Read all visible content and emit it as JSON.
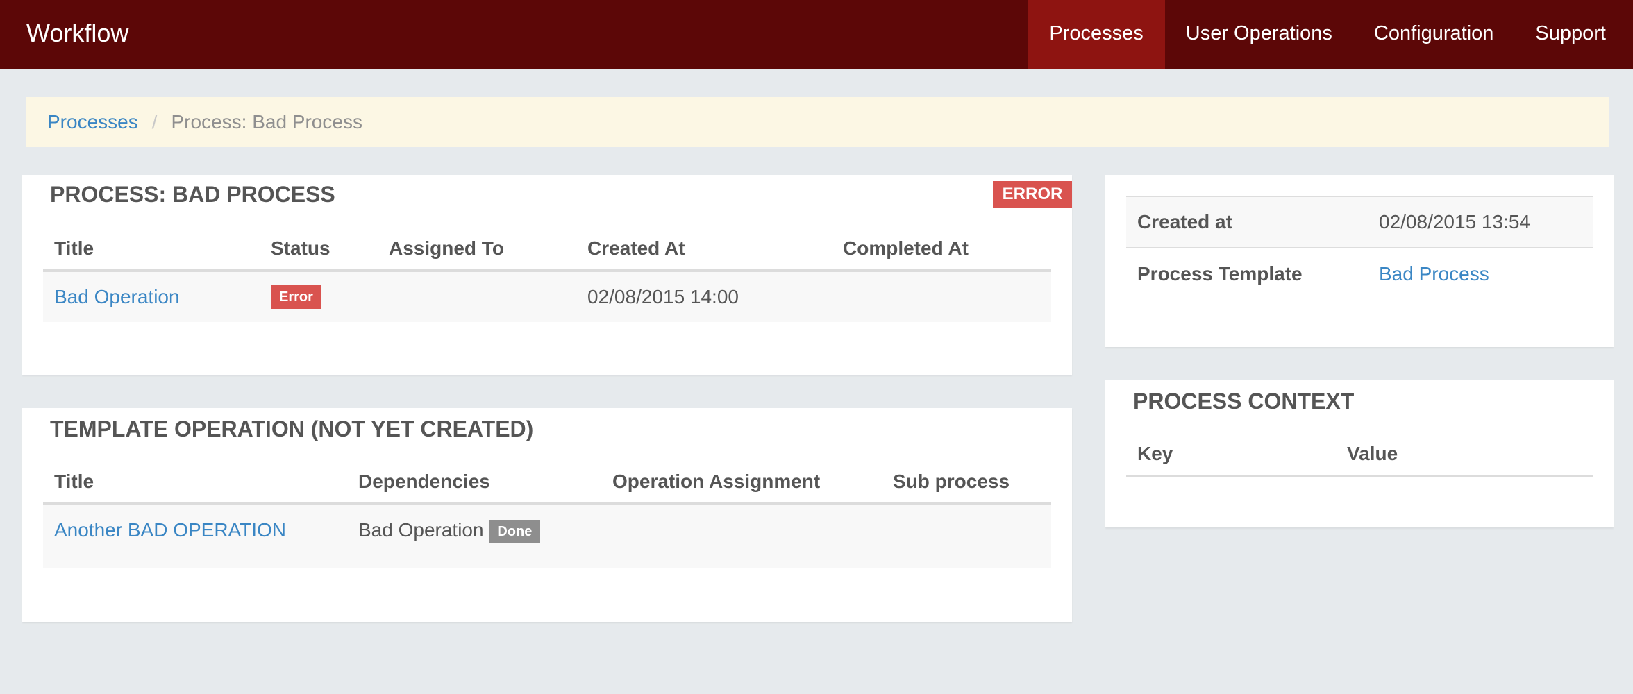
{
  "navbar": {
    "brand": "Workflow",
    "items": [
      {
        "label": "Processes",
        "active": true
      },
      {
        "label": "User Operations"
      },
      {
        "label": "Configuration"
      },
      {
        "label": "Support"
      }
    ]
  },
  "breadcrumb": {
    "link": "Processes",
    "separator": "/",
    "current": "Process: Bad Process"
  },
  "process_panel": {
    "title": "PROCESS: BAD PROCESS",
    "status_label": "ERROR",
    "columns": [
      "Title",
      "Status",
      "Assigned To",
      "Created At",
      "Completed At"
    ],
    "rows": [
      {
        "title": "Bad Operation",
        "status": "Error",
        "assigned_to": "",
        "created_at": "02/08/2015 14:00",
        "completed_at": ""
      }
    ]
  },
  "template_panel": {
    "title": "TEMPLATE OPERATION (NOT YET CREATED)",
    "columns": [
      "Title",
      "Dependencies",
      "Operation Assignment",
      "Sub process"
    ],
    "rows": [
      {
        "title": "Another BAD OPERATION",
        "dependency": "Bad Operation",
        "dependency_status": "Done",
        "assignment": "",
        "sub_process": ""
      }
    ]
  },
  "details_panel": {
    "rows": [
      {
        "key": "Created at",
        "value": "02/08/2015 13:54"
      },
      {
        "key": "Process Template",
        "value": "Bad Process"
      }
    ]
  },
  "context_panel": {
    "title": "PROCESS CONTEXT",
    "columns": [
      "Key",
      "Value"
    ]
  },
  "colors": {
    "navbar_bg": "#5c0707",
    "nav_active_bg": "#8e1411",
    "error": "#d9534f",
    "link": "#3a86c4",
    "breadcrumb_bg": "#fcf7e4",
    "page_bg": "#e6eaed"
  }
}
